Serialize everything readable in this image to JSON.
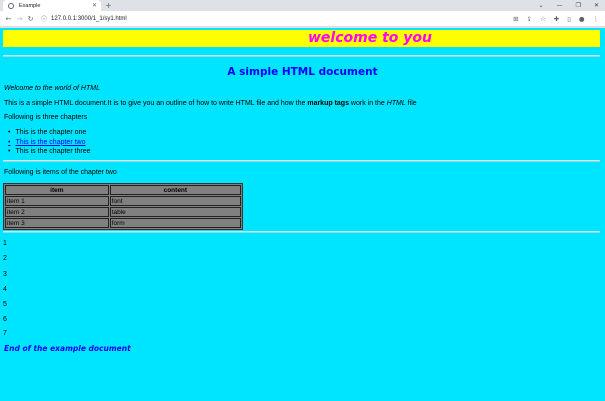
{
  "browser": {
    "tab_title": "Example",
    "tab_close": "✕",
    "new_tab": "+",
    "url": "127.0.0.1:3000/1_1/sy1.html",
    "window_controls": [
      "⌄",
      "—",
      "❐",
      "✕"
    ]
  },
  "page": {
    "banner": "welcome to you",
    "heading": "A simple HTML document",
    "intro": "Welcome to the world of HTML",
    "desc": {
      "part1": "This is a simple HTML document.It is to give you an outline of how to write HTML file and how the ",
      "bold": "markup tags",
      "part2": " work in the ",
      "ital": "HTML",
      "part3": " file"
    },
    "chapters_intro": "Following is three chapters",
    "chapters": [
      "This is the chapter one",
      "This is the chapter two",
      "This is the chapter three"
    ],
    "items_intro": "Following is items of the chapter two",
    "table": {
      "headers": [
        "item",
        "content"
      ],
      "rows": [
        [
          "item 1",
          "font"
        ],
        [
          "item 2",
          "table"
        ],
        [
          "item 3",
          "form"
        ]
      ]
    },
    "numbers": [
      "1",
      "2",
      "3",
      "4",
      "5",
      "6",
      "7"
    ],
    "end": "End of the example document"
  },
  "colors": {
    "page_bg": "#00e5ff",
    "banner_bg": "#ffff00",
    "banner_text": "#ff00ff",
    "heading": "#0000ff",
    "table_bg": "#808080"
  }
}
